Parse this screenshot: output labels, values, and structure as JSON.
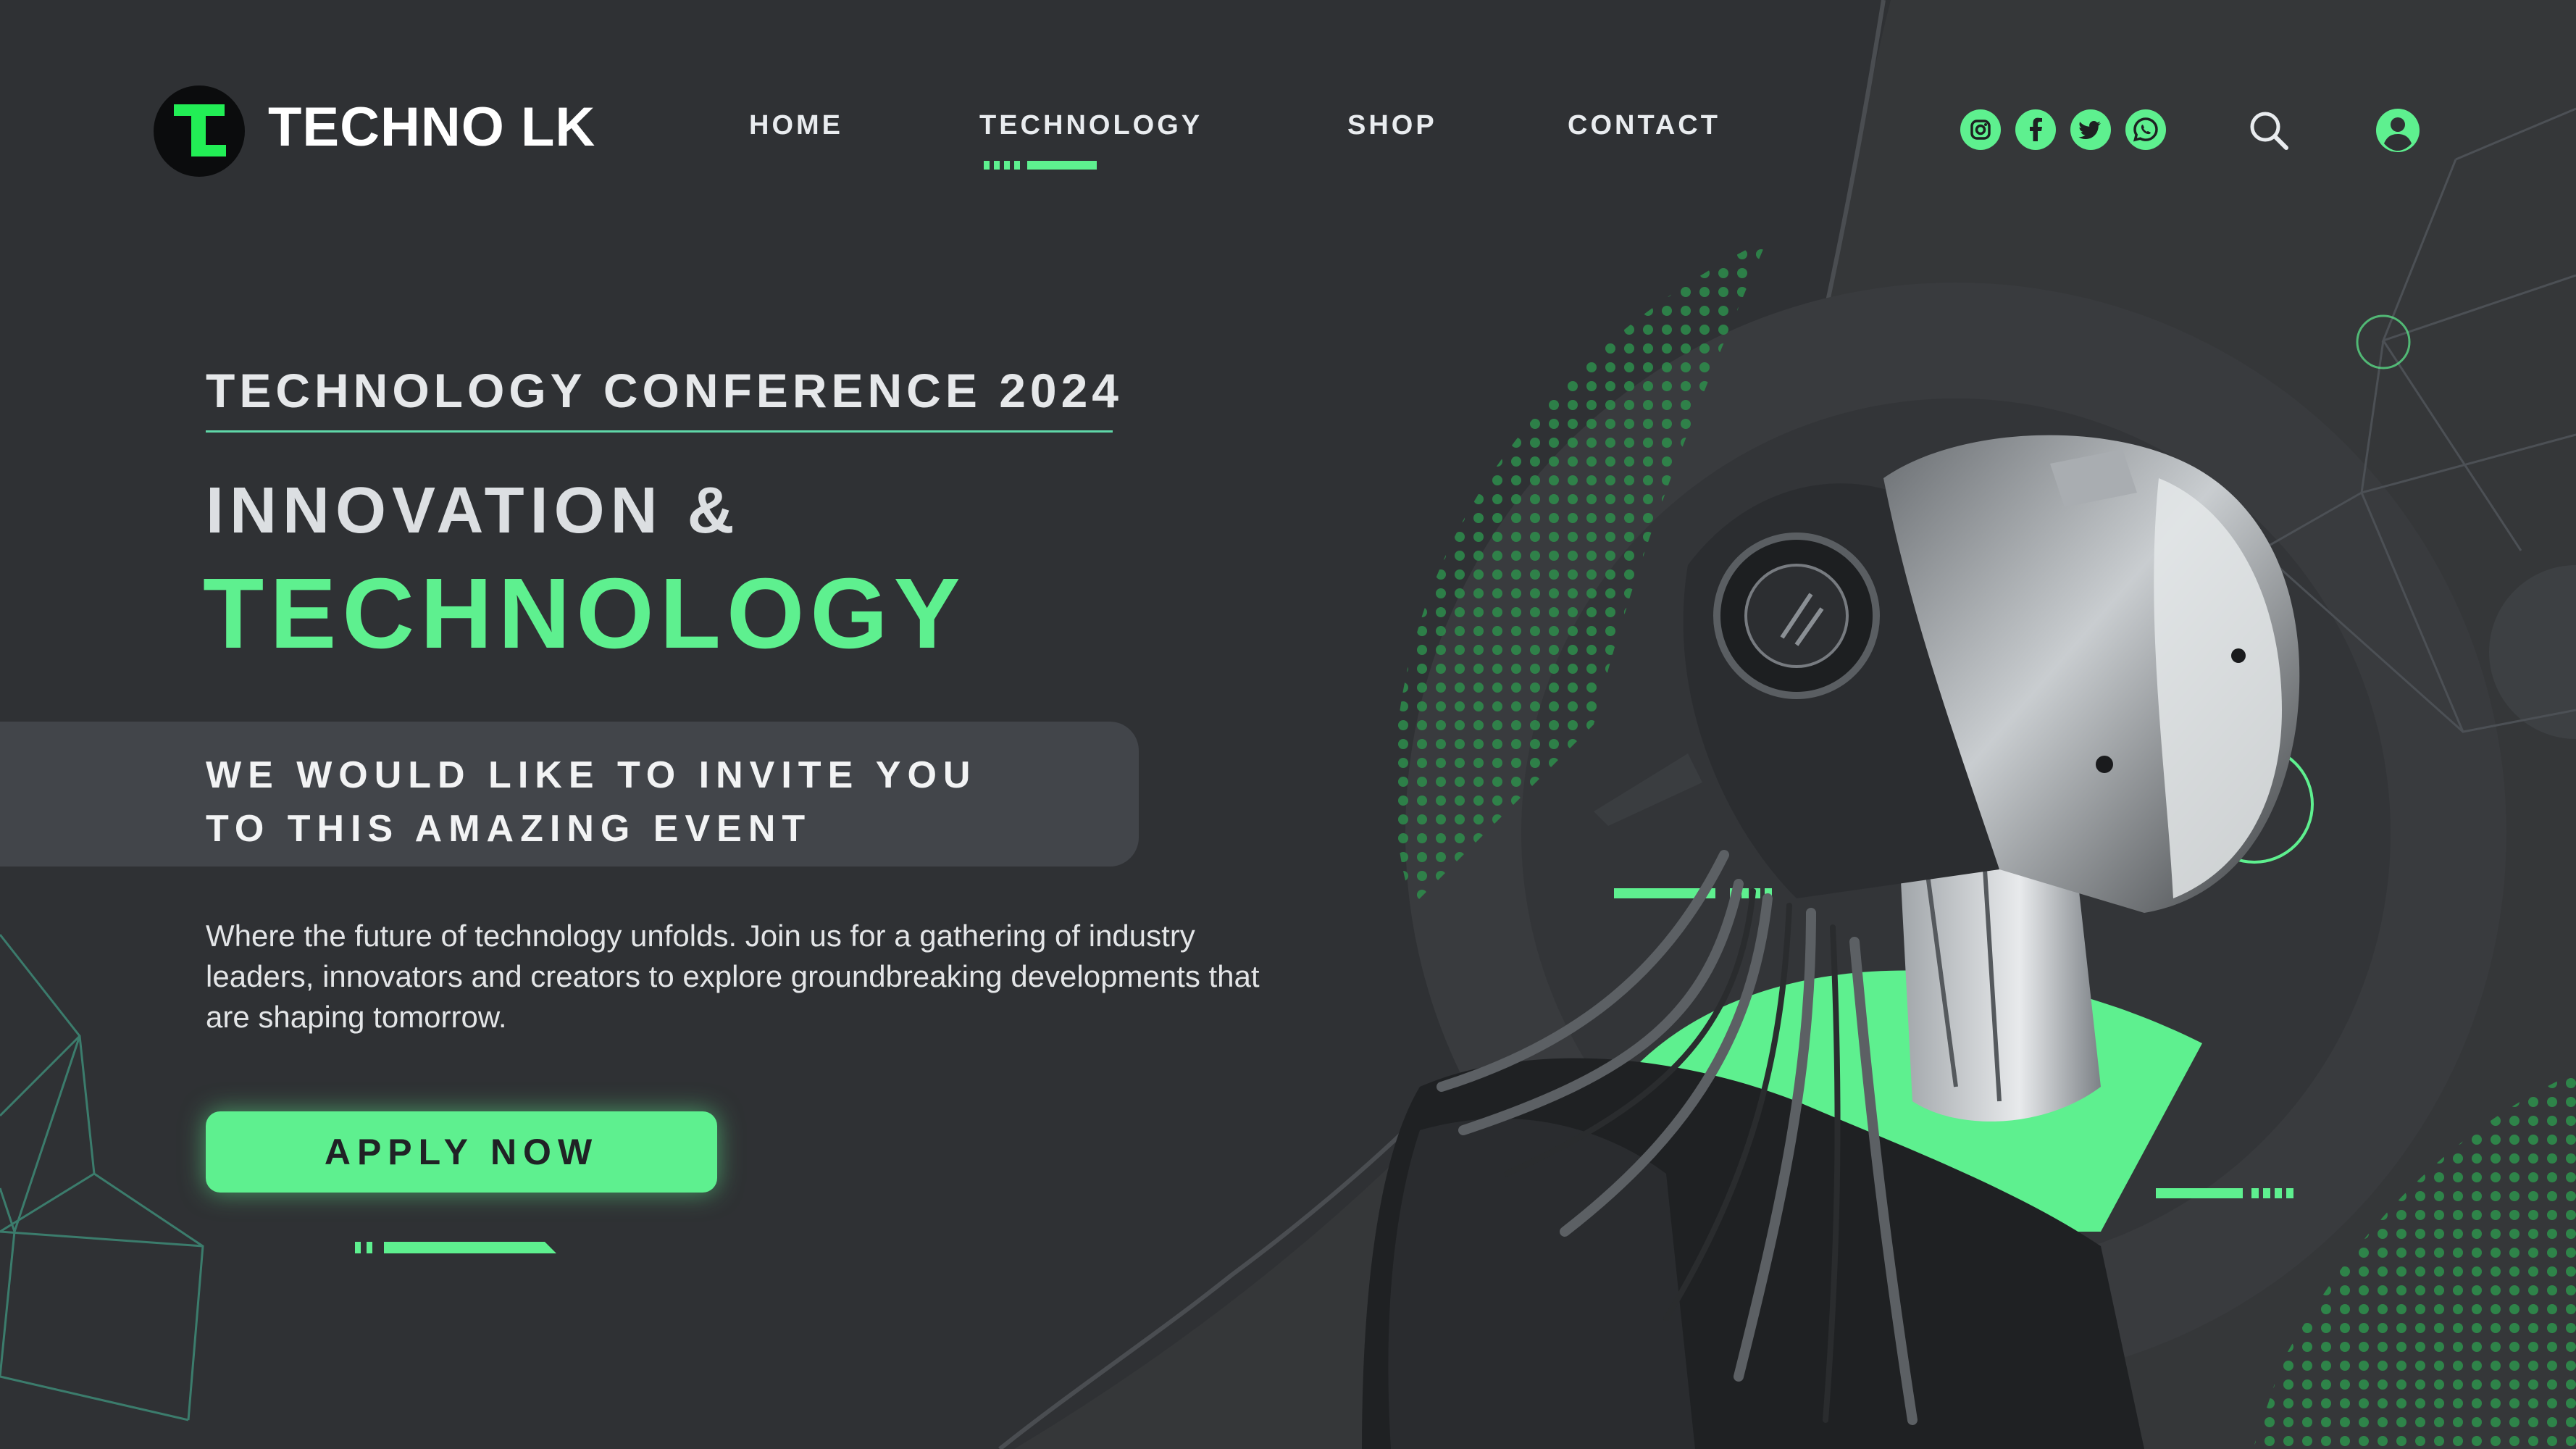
{
  "brand": {
    "name": "TECHNO LK",
    "logo_letter": "L"
  },
  "nav": {
    "items": [
      {
        "label": "HOME"
      },
      {
        "label": "TECHNOLOGY",
        "active": true
      },
      {
        "label": "SHOP"
      },
      {
        "label": "CONTACT"
      }
    ]
  },
  "social": [
    "instagram-icon",
    "facebook-icon",
    "twitter-icon",
    "whatsapp-icon"
  ],
  "hero": {
    "event_title": "TECHNOLOGY CONFERENCE 2024",
    "headline_1": "INNOVATION &",
    "headline_2": "TECHNOLOGY",
    "invite_line_1": "WE WOULD LIKE TO INVITE YOU",
    "invite_line_2": "TO THIS AMAZING EVENT",
    "description": "Where the future of technology unfolds. Join us for a gathering of industry leaders, innovators and creators to explore groundbreaking developments that are shaping tomorrow.",
    "cta": "APPLY NOW"
  },
  "theme": {
    "accent": "#5ef08f",
    "background": "#2f3134",
    "panel": "#42454a",
    "text": "#e9ecef"
  }
}
